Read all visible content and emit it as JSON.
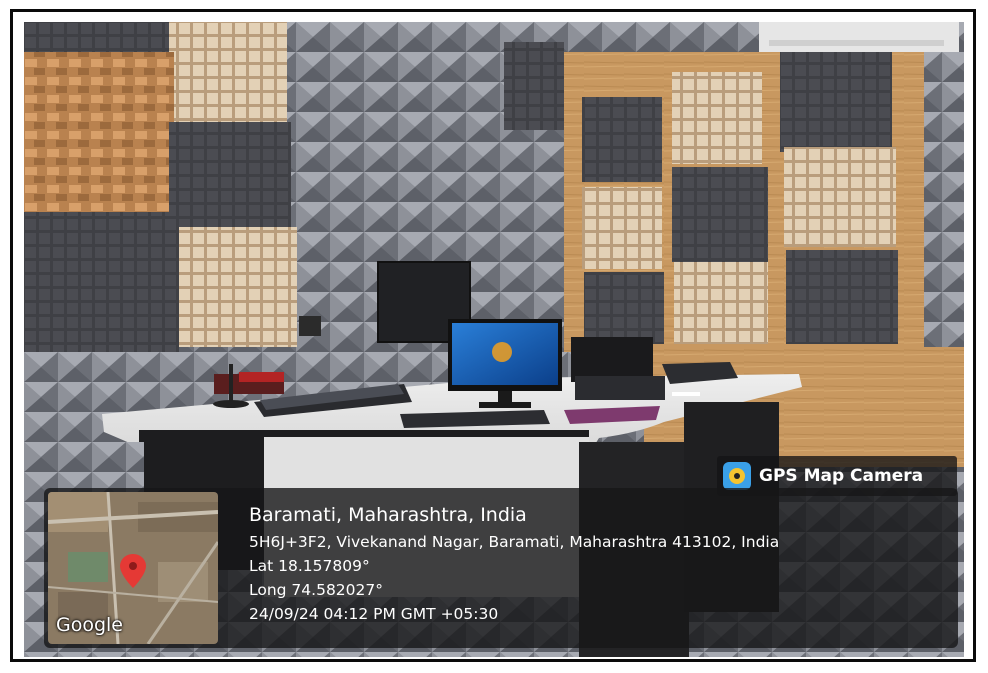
{
  "overlay": {
    "brand_label": "GPS Map Camera",
    "brand_icon": "camera-map-icon",
    "city_line": "Baramati, Maharashtra, India",
    "address_line": "5H6J+3F2, Vivekanand Nagar, Baramati, Maharashtra 413102, India",
    "lat_line": "Lat 18.157809°",
    "long_line": "Long 74.582027°",
    "datetime_line": "24/09/24 04:12 PM GMT +05:30",
    "map_logo": "Google",
    "map_marker_icon": "map-pin-icon"
  },
  "colors": {
    "frame": "#0a0a0a",
    "overlay_bg": "#161618",
    "overlay_text": "#ffffff",
    "pin": "#e53935"
  }
}
